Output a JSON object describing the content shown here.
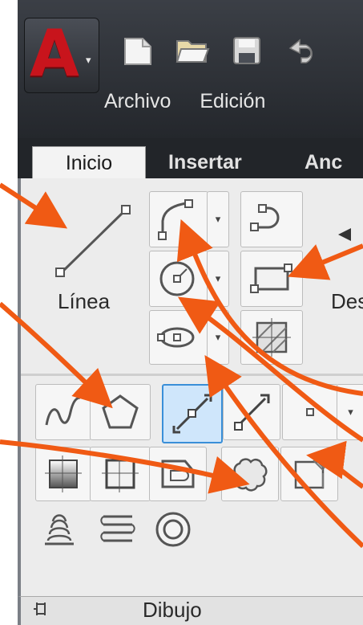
{
  "menubar": {
    "items": [
      "Archivo",
      "Edición"
    ]
  },
  "ribbon": {
    "tabs": [
      "Inicio",
      "Insertar",
      "Anc"
    ]
  },
  "panel": {
    "large_tool_label": "Línea",
    "partial_label": "Des",
    "footer_label": "Dibujo"
  },
  "colors": {
    "arrow": "#f05a14",
    "accent_red": "#c8141c",
    "selected_bg": "#cfe6fb",
    "selected_border": "#3a8fd8"
  },
  "icons": [
    "app-logo-icon",
    "new-file-icon",
    "open-folder-icon",
    "save-icon",
    "undo-icon",
    "line-icon",
    "polyline-icon",
    "circle-icon",
    "ellipse-icon",
    "arc-icon",
    "rectangle-icon",
    "hatch-icon",
    "spline-icon",
    "polygon-icon",
    "construction-line-icon",
    "ray-icon",
    "point-icon",
    "region-icon",
    "wipeout-icon",
    "boundary-icon",
    "revision-cloud-icon",
    "gradient-icon",
    "helix-icon",
    "3d-polyline-icon",
    "donut-icon",
    "pin-icon"
  ]
}
